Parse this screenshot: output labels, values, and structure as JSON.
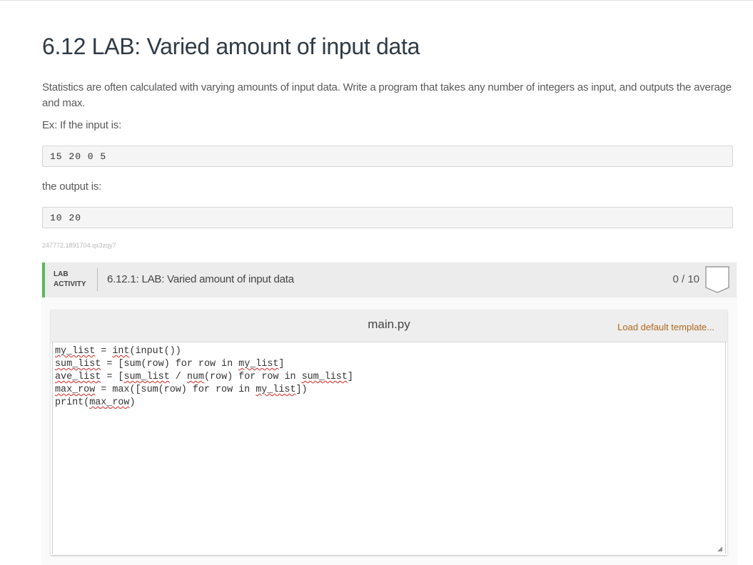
{
  "page": {
    "title": "6.12 LAB: Varied amount of input data",
    "description": "Statistics are often calculated with varying amounts of input data. Write a program that takes any number of integers as input, and outputs the average and max.",
    "example_input_label": "Ex: If the input is:",
    "example_input": "15 20 0 5",
    "example_output_label": "the output is:",
    "example_output": "10 20",
    "reference_id": "247772.1891704.qx3zqy7"
  },
  "lab": {
    "tag_line1": "LAB",
    "tag_line2": "ACTIVITY",
    "title": "6.12.1: LAB: Varied amount of input data",
    "score": "0 / 10",
    "accent_color": "#5cb85c",
    "badge_icon": "shield-badge-icon"
  },
  "editor": {
    "filename": "main.py",
    "load_template_label": "Load default template...",
    "code_lines": [
      "my_list = int(input())",
      "sum_list = [sum(row) for row in my_list]",
      "ave_list = [sum_list / num(row) for row in sum_list]",
      "max_row = max([sum(row) for row in my_list])",
      "print(max_row)"
    ]
  }
}
